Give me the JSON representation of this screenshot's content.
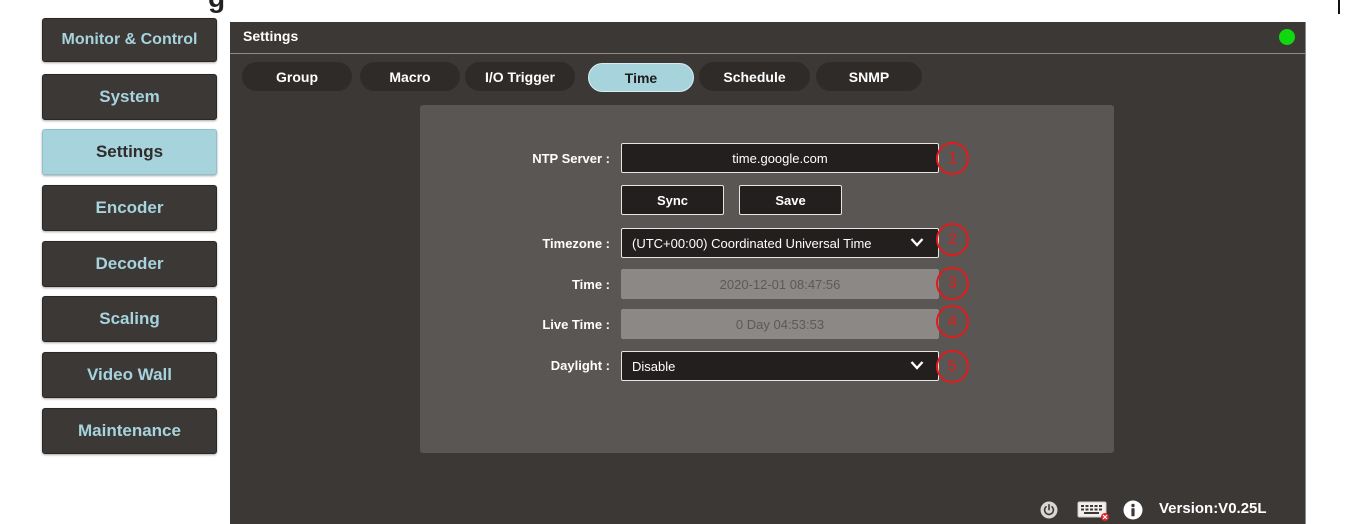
{
  "nav": {
    "items": [
      {
        "label": "Monitor & Control",
        "active": false
      },
      {
        "label": "System",
        "active": false
      },
      {
        "label": "Settings",
        "active": true
      },
      {
        "label": "Encoder",
        "active": false
      },
      {
        "label": "Decoder",
        "active": false
      },
      {
        "label": "Scaling",
        "active": false
      },
      {
        "label": "Video Wall",
        "active": false
      },
      {
        "label": "Maintenance",
        "active": false
      }
    ]
  },
  "panel": {
    "title": "Settings",
    "status_color": "#11d711"
  },
  "tabs": [
    {
      "label": "Group",
      "active": false
    },
    {
      "label": "Macro",
      "active": false
    },
    {
      "label": "I/O Trigger",
      "active": false
    },
    {
      "label": "Time",
      "active": true
    },
    {
      "label": "Schedule",
      "active": false
    },
    {
      "label": "SNMP",
      "active": false
    }
  ],
  "form": {
    "ntp_label": "NTP Server :",
    "ntp_value": "time.google.com",
    "sync_label": "Sync",
    "save_label": "Save",
    "timezone_label": "Timezone :",
    "timezone_value": "(UTC+00:00) Coordinated Universal Time",
    "time_label": "Time :",
    "time_value": "2020-12-01 08:47:56",
    "livetime_label": "Live Time :",
    "livetime_value": "0 Day 04:53:53",
    "daylight_label": "Daylight :",
    "daylight_value": "Disable"
  },
  "callouts": [
    "1",
    "2",
    "3",
    "4",
    "5"
  ],
  "footer": {
    "version": "Version:V0.25L",
    "icons": [
      "power-icon",
      "keyboard-icon",
      "info-icon"
    ]
  },
  "colors": {
    "accent": "#a7d3dd",
    "panel": "#3c3836",
    "card": "#5a5654",
    "callout": "#e21a1a"
  }
}
